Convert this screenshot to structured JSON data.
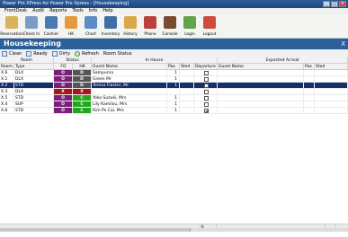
{
  "window": {
    "title": "Power Pro XPress for Power Pro Xpress - [Housekeeping]"
  },
  "menu": [
    "FrontDesk",
    "Audit",
    "Reports",
    "Tools",
    "Info",
    "Help"
  ],
  "toolbar": [
    {
      "label": "Reservation",
      "icon": "reservation-icon",
      "color": "#d8b35a"
    },
    {
      "label": "Check In",
      "icon": "check-in-icon",
      "color": "#7a9cc9"
    },
    {
      "label": "Cashier",
      "icon": "cashier-icon",
      "color": "#4a7ab5"
    },
    {
      "label": "HK",
      "icon": "housekeeping-icon",
      "color": "#e29a3c"
    },
    {
      "label": "Chart",
      "icon": "chart-icon",
      "color": "#5b8cc7"
    },
    {
      "label": "Inventory",
      "icon": "inventory-icon",
      "color": "#3f6fa8"
    },
    {
      "label": "History",
      "icon": "history-icon",
      "color": "#d9a849"
    },
    {
      "label": "Phone",
      "icon": "phone-icon",
      "color": "#b9423a"
    },
    {
      "label": "Console",
      "icon": "console-icon",
      "color": "#7a4b2e"
    },
    {
      "label": "Login",
      "icon": "login-icon",
      "color": "#62a449"
    },
    {
      "label": "Logout",
      "icon": "logout-icon",
      "color": "#cf4b3b"
    }
  ],
  "header": {
    "title": "Housekeeping",
    "close": "X"
  },
  "subtoolbar": {
    "clean": "Clean",
    "ready": "Ready",
    "dirty": "Dirty",
    "refresh": "Refresh",
    "room_status": "Room Status"
  },
  "groups": {
    "room": "Room",
    "status": "Status",
    "in_house": "In House",
    "expected": "Expected Arrival"
  },
  "columns": {
    "room": "Room",
    "type": "Type",
    "fo": "FO",
    "hk": "HK",
    "guest": "Guest Name",
    "pax": "Pax",
    "sted": "Sted",
    "departure": "Departure",
    "e_guest": "Guest Name",
    "e_pax": "Pax",
    "e_sted": "Sted"
  },
  "rows": [
    {
      "room": "X.6",
      "type": "DLX",
      "fo": "O",
      "fo_color": "#7b1f7b",
      "hk": "D",
      "hk_color": "#555555",
      "guest": "Sampurna",
      "pax": "1",
      "sted": "",
      "departure": false,
      "selected": false
    },
    {
      "room": "X.1",
      "type": "DLX",
      "fo": "O",
      "fo_color": "#7b1f7b",
      "hk": "D",
      "hk_color": "#555555",
      "guest": "Green Mr",
      "pax": "1",
      "sted": "",
      "departure": false,
      "selected": false
    },
    {
      "room": "X.2",
      "type": "STD",
      "fo": "O",
      "fo_color": "#7b1f7b",
      "hk": "D",
      "hk_color": "#555555",
      "guest": "Teresa Flaxter, Mr",
      "pax": "1",
      "sted": "",
      "departure": false,
      "selected": true
    },
    {
      "room": "X.3",
      "type": "DLX",
      "fo": "X",
      "fo_color": "#a81616",
      "hk": "X",
      "hk_color": "#a81616",
      "guest": "",
      "pax": "",
      "sted": "",
      "departure": false,
      "selected": false
    },
    {
      "room": "X.5",
      "type": "STD",
      "fo": "O",
      "fo_color": "#7b1f7b",
      "hk": "C",
      "hk_color": "#22a81e",
      "guest": "Yoko Suzuki, Mrs",
      "pax": "1",
      "sted": "",
      "departure": false,
      "selected": false
    },
    {
      "room": "X.4",
      "type": "SUP",
      "fo": "O",
      "fo_color": "#7b1f7b",
      "hk": "C",
      "hk_color": "#22a81e",
      "guest": "Lily Kamilou, Mrs",
      "pax": "1",
      "sted": "",
      "departure": false,
      "selected": false
    },
    {
      "room": "X.6",
      "type": "STD",
      "fo": "O",
      "fo_color": "#7b1f7b",
      "hk": "C",
      "hk_color": "#22a81e",
      "guest": "Kim Pe Cai, Mrs",
      "pax": "1",
      "sted": "",
      "departure": true,
      "selected": false
    }
  ],
  "footer": {
    "count": "6"
  }
}
